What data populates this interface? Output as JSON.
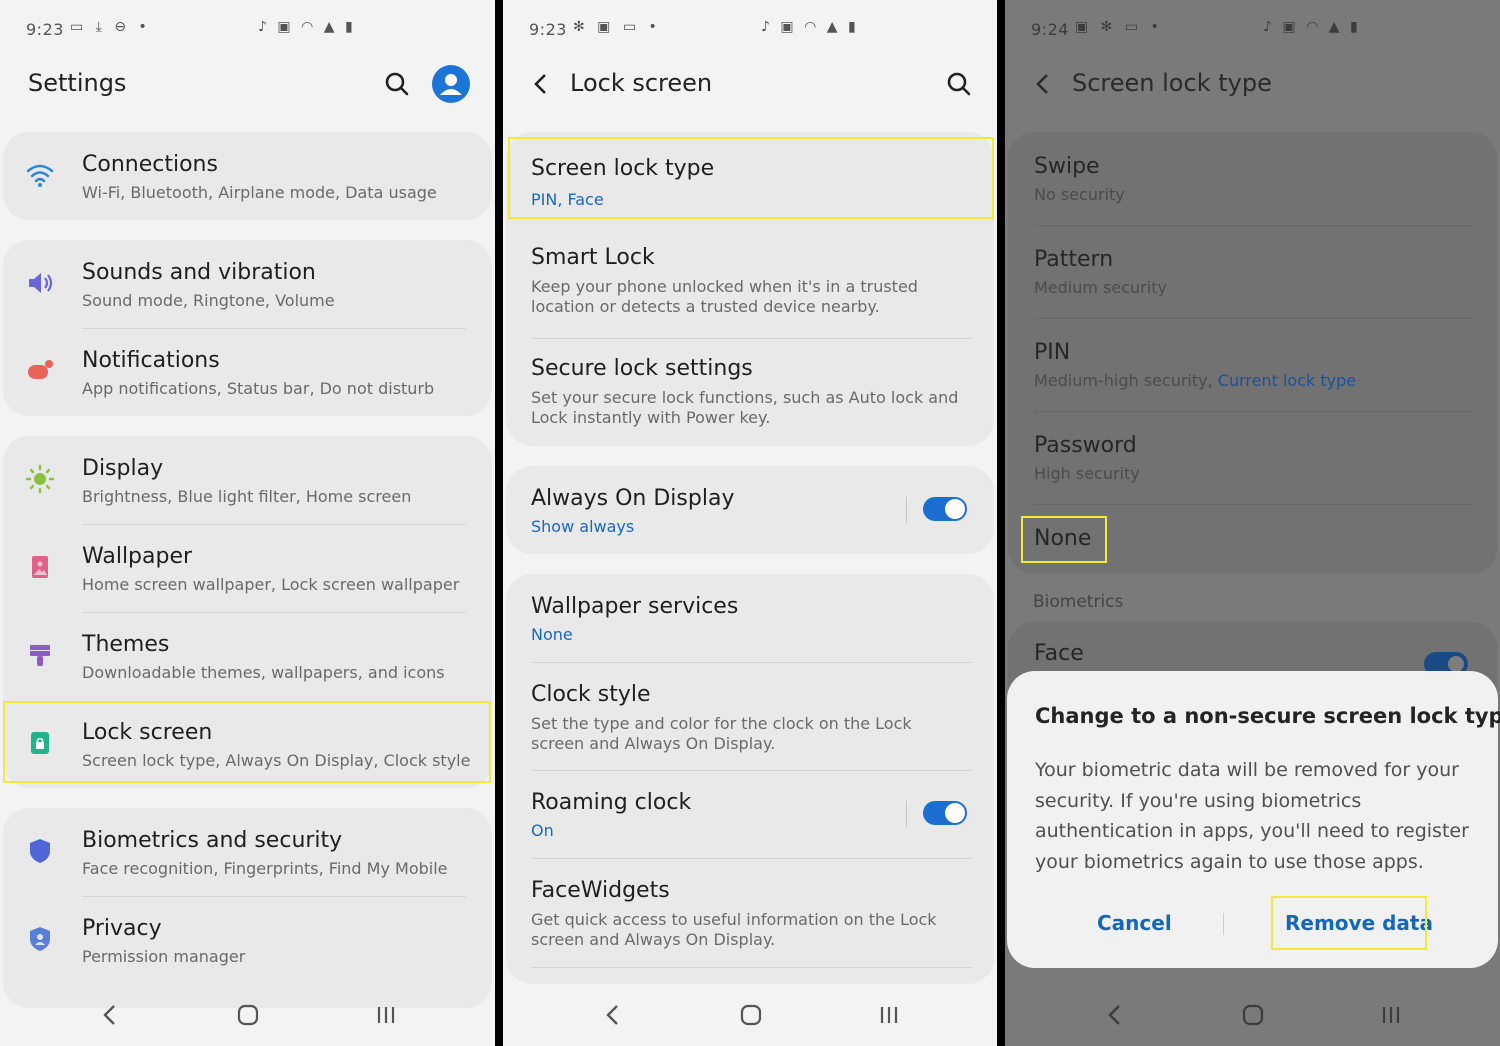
{
  "status": {
    "p1": {
      "time": "9:23"
    },
    "p2": {
      "time": "9:23"
    },
    "p3": {
      "time": "9:24"
    }
  },
  "settings": {
    "title": "Settings",
    "items": [
      {
        "title": "Connections",
        "subtitle": "Wi-Fi, Bluetooth, Airplane mode, Data usage"
      },
      {
        "title": "Sounds and vibration",
        "subtitle": "Sound mode, Ringtone, Volume"
      },
      {
        "title": "Notifications",
        "subtitle": "App notifications, Status bar, Do not disturb"
      },
      {
        "title": "Display",
        "subtitle": "Brightness, Blue light filter, Home screen"
      },
      {
        "title": "Wallpaper",
        "subtitle": "Home screen wallpaper, Lock screen wallpaper"
      },
      {
        "title": "Themes",
        "subtitle": "Downloadable themes, wallpapers, and icons"
      },
      {
        "title": "Lock screen",
        "subtitle": "Screen lock type, Always On Display, Clock style"
      },
      {
        "title": "Biometrics and security",
        "subtitle": "Face recognition, Fingerprints, Find My Mobile"
      },
      {
        "title": "Privacy",
        "subtitle": "Permission manager"
      }
    ]
  },
  "lockscreen": {
    "title": "Lock screen",
    "items": [
      {
        "title": "Screen lock type",
        "subtitle": "PIN, Face"
      },
      {
        "title": "Smart Lock",
        "subtitle": "Keep your phone unlocked when it's in a trusted location or detects a trusted device nearby."
      },
      {
        "title": "Secure lock settings",
        "subtitle": "Set your secure lock functions, such as Auto lock and Lock instantly with Power key."
      },
      {
        "title": "Always On Display",
        "subtitle": "Show always"
      },
      {
        "title": "Wallpaper services",
        "subtitle": "None"
      },
      {
        "title": "Clock style",
        "subtitle": "Set the type and color for the clock on the Lock screen and Always On Display."
      },
      {
        "title": "Roaming clock",
        "subtitle": "On"
      },
      {
        "title": "FaceWidgets",
        "subtitle": "Get quick access to useful information on the Lock screen and Always On Display."
      }
    ]
  },
  "locktype": {
    "title": "Screen lock type",
    "items": [
      {
        "title": "Swipe",
        "subtitle": "No security"
      },
      {
        "title": "Pattern",
        "subtitle": "Medium security"
      },
      {
        "title": "PIN",
        "subtitle": "Medium-high security, ",
        "subtitle_extra": "Current lock type"
      },
      {
        "title": "Password",
        "subtitle": "High security"
      },
      {
        "title": "None"
      }
    ],
    "section_header": "Biometrics",
    "face_label": "Face"
  },
  "dialog": {
    "title": "Change to a non-secure screen lock type?",
    "body": "Your biometric data will be removed for your security. If you're using biometrics authentication in apps, you'll need to register your biometrics again to use those apps.",
    "cancel": "Cancel",
    "confirm": "Remove data"
  },
  "colors": {
    "highlight": "#f2ea3b",
    "accent_blue": "#1668c4",
    "toggle_on": "#1b6fd0"
  },
  "icons": [
    "wifi-icon",
    "volume-icon",
    "notification-icon",
    "display-icon",
    "wallpaper-icon",
    "themes-icon",
    "lock-icon",
    "shield-icon",
    "privacy-shield-icon",
    "search-icon",
    "avatar",
    "back-icon",
    "nav-back-icon",
    "nav-home-icon",
    "nav-recents-icon"
  ]
}
